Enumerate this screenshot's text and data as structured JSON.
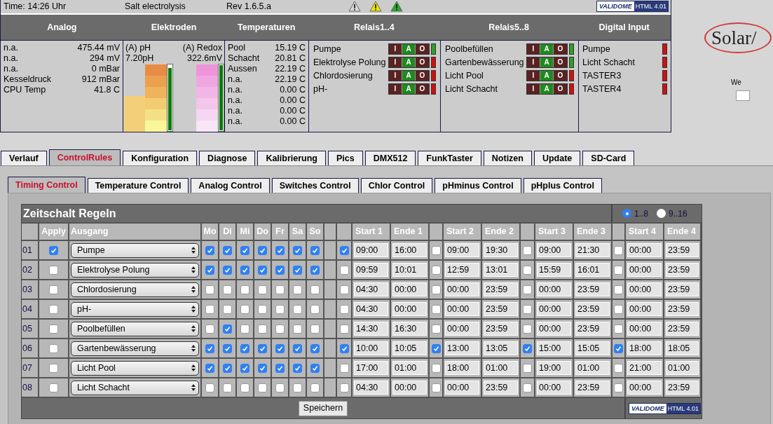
{
  "header": {
    "time": "Time: 14:26 Uhr",
    "title": "Salt electrolysis",
    "revision": "Rev 1.6.5.a",
    "alerts": [
      {
        "color": "#d8d8d8"
      },
      {
        "color": "#f2e200"
      },
      {
        "color": "#22b022"
      }
    ],
    "badge": {
      "logo": "VALIDOME",
      "version": "HTML 4.01"
    }
  },
  "sections": [
    "Analog",
    "Elektroden",
    "Temperaturen",
    "Relais1..4",
    "Relais5..8",
    "Digital Input"
  ],
  "analog": [
    {
      "label": "n.a.",
      "value": "475.44 mV"
    },
    {
      "label": "n.a.",
      "value": "294 mV"
    },
    {
      "label": "n.a.",
      "value": "0 mBar"
    },
    {
      "label": "Kesseldruck",
      "value": "912 mBar"
    },
    {
      "label": "CPU Temp",
      "value": "41.8 C"
    }
  ],
  "electrodes": [
    {
      "kind": "ph",
      "label": "(A) pH",
      "value": "7.20pH",
      "level": 0.96
    },
    {
      "kind": "redox",
      "label": "(A) Redox",
      "value": "322.6mV",
      "level": 1
    }
  ],
  "temperatures": [
    {
      "label": "Pool",
      "value": "15.19 C"
    },
    {
      "label": "Schacht",
      "value": "20.81 C"
    },
    {
      "label": "Aussen",
      "value": "22.19 C"
    },
    {
      "label": "n.a.",
      "value": "22.19 C"
    },
    {
      "label": "n.a.",
      "value": "0.00 C"
    },
    {
      "label": "n.a.",
      "value": "0.00 C"
    },
    {
      "label": "n.a.",
      "value": "0.00 C"
    },
    {
      "label": "n.a.",
      "value": "0.00 C"
    }
  ],
  "relays_1_4": [
    {
      "name": "Pumpe",
      "on": true,
      "switch": [
        {
          "label": "I",
          "selected": false
        },
        {
          "label": "A",
          "selected": true
        },
        {
          "label": "O",
          "selected": false
        }
      ]
    },
    {
      "name": "Elektrolyse Polung",
      "on": false,
      "switch": [
        {
          "label": "I",
          "selected": false
        },
        {
          "label": "A",
          "selected": true
        },
        {
          "label": "O",
          "selected": false
        }
      ]
    },
    {
      "name": "Chlordosierung",
      "on": false,
      "switch": [
        {
          "label": "I",
          "selected": false
        },
        {
          "label": "A",
          "selected": true
        },
        {
          "label": "O",
          "selected": false
        }
      ]
    },
    {
      "name": "pH-",
      "on": false,
      "switch": [
        {
          "label": "I",
          "selected": false
        },
        {
          "label": "A",
          "selected": true
        },
        {
          "label": "O",
          "selected": false
        }
      ]
    }
  ],
  "relays_5_8": [
    {
      "name": "Poolbefüllen",
      "on": true,
      "switch": [
        {
          "label": "I",
          "selected": false
        },
        {
          "label": "A",
          "selected": true
        },
        {
          "label": "O",
          "selected": false
        }
      ]
    },
    {
      "name": "Gartenbewässerung",
      "on": true,
      "switch": [
        {
          "label": "I",
          "selected": false
        },
        {
          "label": "A",
          "selected": true
        },
        {
          "label": "O",
          "selected": false
        }
      ]
    },
    {
      "name": "Licht Pool",
      "on": false,
      "switch": [
        {
          "label": "I",
          "selected": false
        },
        {
          "label": "A",
          "selected": true
        },
        {
          "label": "O",
          "selected": false
        }
      ]
    },
    {
      "name": "Licht Schacht",
      "on": false,
      "switch": [
        {
          "label": "I",
          "selected": false
        },
        {
          "label": "A",
          "selected": true
        },
        {
          "label": "O",
          "selected": false
        }
      ]
    }
  ],
  "digital_inputs": [
    {
      "name": "Pumpe",
      "on": false
    },
    {
      "name": "Licht Schacht",
      "on": false
    },
    {
      "name": "TASTER3",
      "on": false
    },
    {
      "name": "TASTER4",
      "on": false
    }
  ],
  "side": {
    "logo": "Solar/",
    "label": "We"
  },
  "tabs": [
    {
      "label": "Verlauf",
      "selected": false
    },
    {
      "label": "ControlRules",
      "selected": true
    },
    {
      "label": "Konfiguration",
      "selected": false
    },
    {
      "label": "Diagnose",
      "selected": false
    },
    {
      "label": "Kalibrierung",
      "selected": false
    },
    {
      "label": "Pics",
      "selected": false
    },
    {
      "label": "DMX512",
      "selected": false
    },
    {
      "label": "FunkTaster",
      "selected": false
    },
    {
      "label": "Notizen",
      "selected": false
    },
    {
      "label": "Update",
      "selected": false
    },
    {
      "label": "SD-Card",
      "selected": false
    }
  ],
  "subtabs": [
    {
      "label": "Timing Control",
      "selected": true
    },
    {
      "label": "Temperature Control",
      "selected": false
    },
    {
      "label": "Analog Control",
      "selected": false
    },
    {
      "label": "Switches Control",
      "selected": false
    },
    {
      "label": "Chlor Control",
      "selected": false
    },
    {
      "label": "pHminus Control",
      "selected": false
    },
    {
      "label": "pHplus Control",
      "selected": false
    }
  ],
  "rules": {
    "title": "Zeitschalt Regeln",
    "pages": [
      {
        "label": "1..8",
        "selected": true
      },
      {
        "label": "9..16",
        "selected": false
      }
    ],
    "columns": {
      "apply": "Apply",
      "output": "Ausgang",
      "days": [
        "Mo",
        "Di",
        "Mi",
        "Do",
        "Fr",
        "Sa",
        "So"
      ],
      "slots": [
        {
          "start": "Start 1",
          "end": "Ende 1"
        },
        {
          "start": "Start 2",
          "end": "Ende 2"
        },
        {
          "start": "Start 3",
          "end": "Ende 3"
        },
        {
          "start": "Start 4",
          "end": "Ende 4"
        }
      ]
    },
    "rows": [
      {
        "number": "01",
        "apply": true,
        "output": "Pumpe",
        "days": [
          true,
          true,
          true,
          true,
          true,
          true,
          true
        ],
        "slots": [
          {
            "enabled": true,
            "start": "09:00",
            "end": "16:00"
          },
          {
            "enabled": false,
            "start": "09:00",
            "end": "19:30"
          },
          {
            "enabled": false,
            "start": "09:00",
            "end": "21:30"
          },
          {
            "enabled": false,
            "start": "00:00",
            "end": "23:59"
          }
        ]
      },
      {
        "number": "02",
        "apply": false,
        "output": "Elektrolyse Polung",
        "days": [
          true,
          true,
          true,
          true,
          true,
          true,
          true
        ],
        "slots": [
          {
            "enabled": false,
            "start": "09:59",
            "end": "10:01"
          },
          {
            "enabled": false,
            "start": "12:59",
            "end": "13:01"
          },
          {
            "enabled": false,
            "start": "15:59",
            "end": "16:01"
          },
          {
            "enabled": false,
            "start": "00:00",
            "end": "23:59"
          }
        ]
      },
      {
        "number": "03",
        "apply": false,
        "output": "Chlordosierung",
        "days": [
          false,
          false,
          false,
          false,
          false,
          false,
          false
        ],
        "slots": [
          {
            "enabled": false,
            "start": "04:30",
            "end": "00:00"
          },
          {
            "enabled": false,
            "start": "00:00",
            "end": "23:59"
          },
          {
            "enabled": false,
            "start": "00:00",
            "end": "23:59"
          },
          {
            "enabled": false,
            "start": "00:00",
            "end": "23:59"
          }
        ]
      },
      {
        "number": "04",
        "apply": false,
        "output": "pH-",
        "days": [
          false,
          false,
          false,
          false,
          false,
          false,
          false
        ],
        "slots": [
          {
            "enabled": false,
            "start": "04:30",
            "end": "00:00"
          },
          {
            "enabled": false,
            "start": "00:00",
            "end": "23:59"
          },
          {
            "enabled": false,
            "start": "00:00",
            "end": "23:59"
          },
          {
            "enabled": false,
            "start": "00:00",
            "end": "23:59"
          }
        ]
      },
      {
        "number": "05",
        "apply": false,
        "output": "Poolbefüllen",
        "days": [
          false,
          true,
          false,
          false,
          false,
          false,
          false
        ],
        "slots": [
          {
            "enabled": false,
            "start": "14:30",
            "end": "16:30"
          },
          {
            "enabled": false,
            "start": "00:00",
            "end": "23:59"
          },
          {
            "enabled": false,
            "start": "00:00",
            "end": "23:59"
          },
          {
            "enabled": false,
            "start": "00:00",
            "end": "23:59"
          }
        ]
      },
      {
        "number": "06",
        "apply": false,
        "output": "Gartenbewässerung",
        "days": [
          true,
          true,
          true,
          true,
          true,
          true,
          true
        ],
        "slots": [
          {
            "enabled": true,
            "start": "10:00",
            "end": "10:05"
          },
          {
            "enabled": true,
            "start": "13:00",
            "end": "13:05"
          },
          {
            "enabled": true,
            "start": "15:00",
            "end": "15:05"
          },
          {
            "enabled": true,
            "start": "18:00",
            "end": "18:05"
          }
        ]
      },
      {
        "number": "07",
        "apply": false,
        "output": "Licht Pool",
        "days": [
          true,
          true,
          true,
          true,
          true,
          true,
          true
        ],
        "slots": [
          {
            "enabled": false,
            "start": "17:00",
            "end": "01:00"
          },
          {
            "enabled": false,
            "start": "18:00",
            "end": "01:00"
          },
          {
            "enabled": false,
            "start": "19:00",
            "end": "01:00"
          },
          {
            "enabled": false,
            "start": "21:00",
            "end": "01:00"
          }
        ]
      },
      {
        "number": "08",
        "apply": false,
        "output": "Licht Schacht",
        "days": [
          false,
          false,
          false,
          false,
          false,
          false,
          false
        ],
        "slots": [
          {
            "enabled": false,
            "start": "04:30",
            "end": "00:00"
          },
          {
            "enabled": false,
            "start": "00:00",
            "end": "23:59"
          },
          {
            "enabled": false,
            "start": "00:00",
            "end": "23:59"
          },
          {
            "enabled": false,
            "start": "00:00",
            "end": "23:59"
          }
        ]
      }
    ],
    "save_button": "Speichern",
    "badge": {
      "logo": "VALIDOME",
      "version": "HTML 4.01"
    }
  }
}
